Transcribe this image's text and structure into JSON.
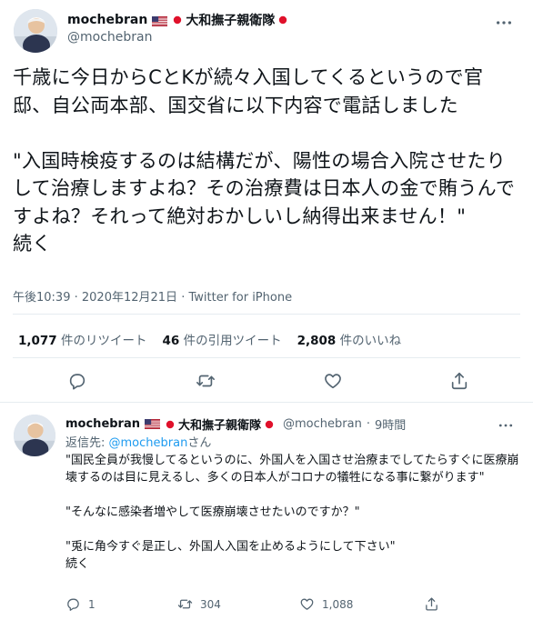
{
  "main_tweet": {
    "display_name": "mochebran",
    "group_name": "大和撫子親衛隊",
    "handle": "@mochebran",
    "text": "千歳に今日からCとKが続々入国してくるというので官邸、自公両本部、国交省に以下内容で電話しました\n\n\"入国時検疫するのは結構だが、陽性の場合入院させたりして治療しますよね？その治療費は日本人の金で賄うんですよね？それって絶対おかしいし納得出来ません！\"\n続く",
    "time": "午後10:39",
    "date": "2020年12月21日",
    "dot": "·",
    "client": "Twitter for iPhone",
    "retweets": {
      "count": "1,077",
      "label": "件のリツイート"
    },
    "quotes": {
      "count": "46",
      "label": "件の引用ツイート"
    },
    "likes": {
      "count": "2,808",
      "label": "件のいいね"
    }
  },
  "reply_tweet": {
    "display_name": "mochebran",
    "group_name": "大和撫子親衛隊",
    "handle": "@mochebran",
    "dot": "·",
    "time_ago": "9時間",
    "replying_prefix": "返信先: ",
    "replying_to": "@mochebran",
    "replying_suffix": "さん",
    "text": "\"国民全員が我慢してるというのに、外国人を入国させ治療までしてたらすぐに医療崩壊するのは目に見えるし、多くの日本人がコロナの犠牲になる事に繋がります\"\n\n\"そんなに感染者増やして医療崩壊させたいのですか？\"\n\n\"兎に角今すぐ是正し、外国人入国を止めるようにして下さい\"\n続く",
    "reply_count": "1",
    "retweet_count": "304",
    "like_count": "1,088"
  },
  "icons": {
    "more": "more-icon",
    "reply": "reply-icon",
    "retweet": "retweet-icon",
    "like": "like-icon",
    "share": "share-icon",
    "flag_us": "us-flag-icon",
    "flag_jp": "japan-flag-icon"
  },
  "colors": {
    "link": "#1d9bf0",
    "secondary_text": "#536471",
    "divider": "#e6ecf0"
  }
}
